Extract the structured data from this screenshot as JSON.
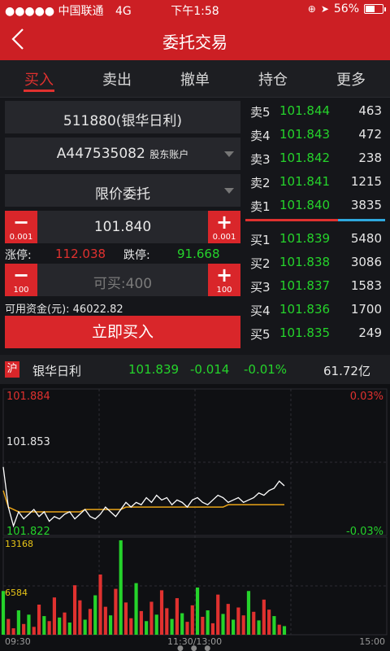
{
  "status_bar": {
    "carrier": "●●●●● 中国联通",
    "network": "4G",
    "time": "下午1:58",
    "battery": "56%",
    "battery_level": 0.56
  },
  "header": {
    "back_icon": "chevron-left-icon",
    "title": "委托交易"
  },
  "tabs": [
    {
      "label": "买入",
      "active": true
    },
    {
      "label": "卖出",
      "active": false
    },
    {
      "label": "撤单",
      "active": false
    },
    {
      "label": "持仓",
      "active": false
    },
    {
      "label": "更多",
      "active": false
    }
  ],
  "order_form": {
    "stock": "511880(银华日利)",
    "account": "A447535082",
    "account_suffix": "股东账户",
    "order_type": "限价委托",
    "price": {
      "minus": "−",
      "plus": "+",
      "step": "0.001",
      "value": "101.840"
    },
    "limit_up_label": "涨停:",
    "limit_up_value": "112.038",
    "limit_down_label": "跌停:",
    "limit_down_value": "91.668",
    "quantity": {
      "minus": "−",
      "plus": "+",
      "step": "100",
      "placeholder": "可买:400"
    },
    "available_funds": "可用资金(元): 46022.82",
    "buy_button": "立即买入"
  },
  "order_book": {
    "asks": [
      {
        "label": "卖5",
        "price": "101.844",
        "qty": "463"
      },
      {
        "label": "卖4",
        "price": "101.843",
        "qty": "472"
      },
      {
        "label": "卖3",
        "price": "101.842",
        "qty": "238"
      },
      {
        "label": "卖2",
        "price": "101.841",
        "qty": "1215"
      },
      {
        "label": "卖1",
        "price": "101.840",
        "qty": "3835"
      }
    ],
    "bids": [
      {
        "label": "买1",
        "price": "101.839",
        "qty": "5480"
      },
      {
        "label": "买2",
        "price": "101.838",
        "qty": "3086"
      },
      {
        "label": "买3",
        "price": "101.837",
        "qty": "1583"
      },
      {
        "label": "买4",
        "price": "101.836",
        "qty": "1700"
      },
      {
        "label": "买5",
        "price": "101.835",
        "qty": "249"
      }
    ]
  },
  "quote_bar": {
    "market_badge": "沪",
    "name": "银华日利",
    "price": "101.839",
    "change": "-0.014",
    "change_pct": "-0.01%",
    "turnover": "61.72亿"
  },
  "chart_data": {
    "type": "line",
    "y_max_label": "101.884",
    "y_mid_label": "101.853",
    "y_min_label": "101.822",
    "pct_max_label": "0.03%",
    "pct_min_label": "-0.03%",
    "volume_max_label": "13168",
    "volume_mid_label": "6584",
    "x_labels": [
      "09:30",
      "11:30/13:00",
      "15:00"
    ],
    "ylim": [
      101.822,
      101.884
    ],
    "price_series": [
      101.851,
      101.834,
      101.826,
      101.832,
      101.829,
      101.831,
      101.833,
      101.83,
      101.832,
      101.828,
      101.83,
      101.829,
      101.831,
      101.832,
      101.829,
      101.831,
      101.833,
      101.83,
      101.829,
      101.831,
      101.834,
      101.832,
      101.83,
      101.833,
      101.836,
      101.834,
      101.836,
      101.835,
      101.838,
      101.836,
      101.839,
      101.837,
      101.838,
      101.835,
      101.837,
      101.836,
      101.834,
      101.837,
      101.838,
      101.836,
      101.835,
      101.837,
      101.839,
      101.838,
      101.836,
      101.837,
      101.838,
      101.836,
      101.837,
      101.838,
      101.84,
      101.839,
      101.841,
      101.842,
      101.845,
      101.843
    ],
    "avg_series": [
      101.841,
      101.834,
      101.833,
      101.832,
      101.832,
      101.832,
      101.832,
      101.832,
      101.832,
      101.832,
      101.832,
      101.832,
      101.832,
      101.832,
      101.832,
      101.832,
      101.833,
      101.833,
      101.833,
      101.833,
      101.833,
      101.833,
      101.833,
      101.833,
      101.834,
      101.834,
      101.834,
      101.834,
      101.834,
      101.834,
      101.834,
      101.834,
      101.834,
      101.834,
      101.834,
      101.834,
      101.834,
      101.834,
      101.834,
      101.834,
      101.834,
      101.834,
      101.834,
      101.834,
      101.835,
      101.835,
      101.835,
      101.835,
      101.835,
      101.835,
      101.835,
      101.835,
      101.835,
      101.835,
      101.835,
      101.835
    ],
    "volume_series": [
      6100,
      2200,
      900,
      3400,
      1500,
      2800,
      1100,
      4200,
      2600,
      1900,
      5200,
      2400,
      3100,
      1700,
      6900,
      4800,
      2100,
      3600,
      5500,
      8400,
      3900,
      2700,
      6400,
      13168,
      4500,
      2300,
      7200,
      3300,
      1900,
      4600,
      2800,
      6200,
      3700,
      2200,
      5100,
      3000,
      1800,
      4100,
      6584,
      2500,
      3400,
      1600,
      5600,
      2900,
      4300,
      2100,
      3800,
      2700,
      6100,
      3200,
      2000,
      4900,
      3500,
      2600,
      1400,
      1200
    ],
    "volume_colors": [
      "green",
      "red",
      "red",
      "green",
      "red",
      "green",
      "red",
      "red",
      "green",
      "red",
      "red",
      "green",
      "red",
      "green",
      "red",
      "red",
      "green",
      "red",
      "green",
      "red",
      "red",
      "green",
      "red",
      "green",
      "red",
      "red",
      "green",
      "red",
      "green",
      "red",
      "green",
      "red",
      "red",
      "green",
      "red",
      "green",
      "red",
      "red",
      "green",
      "red",
      "green",
      "red",
      "red",
      "green",
      "red",
      "green",
      "red",
      "red",
      "green",
      "red",
      "green",
      "red",
      "red",
      "green",
      "red",
      "green"
    ],
    "colors": {
      "price": "#ffffff",
      "avg": "#e8a317",
      "up": "#e0312f",
      "down": "#25d32b"
    }
  }
}
